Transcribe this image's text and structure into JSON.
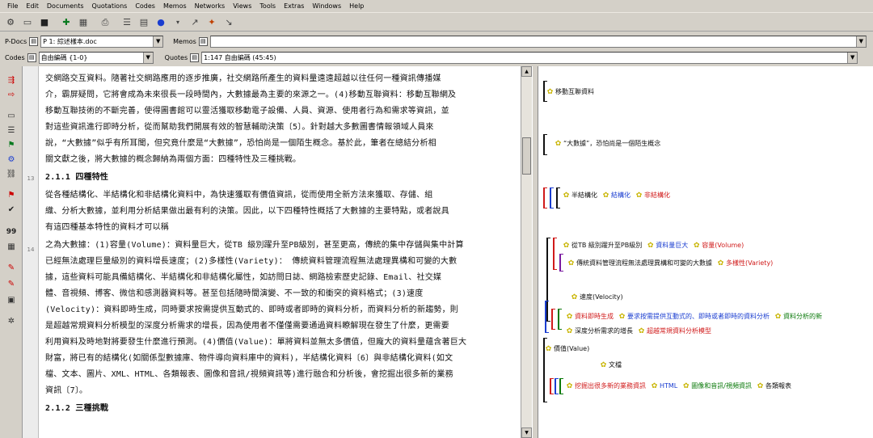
{
  "menu": [
    "File",
    "Edit",
    "Documents",
    "Quotations",
    "Codes",
    "Memos",
    "Networks",
    "Views",
    "Tools",
    "Extras",
    "Windows",
    "Help"
  ],
  "toolbar_icons": [
    "hermeneutic-unit-icon",
    "open-icon",
    "save-icon",
    "add-doc-icon",
    "print-icon",
    "grid-icon",
    "list-icon",
    "network-icon",
    "link-icon",
    "star-icon",
    "cursor-icon"
  ],
  "pdocs": {
    "label": "P-Docs",
    "value": "P 1: 綜述樣本.doc"
  },
  "memos": {
    "label": "Memos",
    "value": ""
  },
  "codes": {
    "label": "Codes",
    "value": "自由編碼 {1-0}"
  },
  "quotes": {
    "label": "Quotes",
    "value": "1:147 自由編碼 (45:45)"
  },
  "line_numbers": [
    "13",
    "14"
  ],
  "text_lines": [
    "交網路交互資料。隨著社交網路應用的逐步推廣，社交網路所產生的資料量遠遠超越以往任何一種資訊傳播媒",
    "介，霸屏疑問，它將會成為未來很長一段時間內，大數據最為主要的來源之一。(4)移動互聯資料：移動互聯網及",
    "移動互聯技術的不斷完善，使得圖書館可以靈活獲取移動電子設備、人員、資源、使用者行為和需求等資訊，並",
    "對這些資訊進行即時分析，從而幫助我們開展有效的智慧輔助決策〔5〕。針對越大多數圖書情報領域人員來",
    "說，“大數據”似乎有所耳聞，但究竟什麼是“大數據”，恐怕尚是一個陌生概念。基於此，筆者在總結分析相",
    "關文獻之後，將大數據的概念歸納為兩個方面：四種特性及三種挑戰。",
    "2.1.1 四種特性",
    "  從各種結構化、半結構化和非結構化資料中，為快速獲取有價值資訊，從而使用全新方法來獲取、存儲、組",
    "織、分析大數據，並利用分析結果做出最有利的決策。因此，以下四種特性概括了大數據的主要特點，或者說具",
    "有這四種基本特性的資料才可以稱",
    "之為大數據：(1)容量(Volume)：資料量巨大，從TB 級別躍升至PB級別，甚至更高，傳統的集中存儲與集中計算",
    "已經無法處理巨量級別的資料增長速度；(2)多樣性(Variety)： 傳統資料管理流程無法處理異構和可變的大數",
    "據，這些資料可能具備結構化、半結構化和非結構化屬性，如訪問日誌、網路檢索歷史記錄、Email、社交媒",
    "體、音視頻、博客、微信和感測器資料等。甚至包括隨時間演變、不一致的和衝突的資料格式；(3)速度",
    "(Velocity)：資料即時生成，同時要求按需提供互動式的、即時或者即時的資料分析，而資料分析的新趨勢，則",
    "是超越常規資料分析模型的深度分析需求的增長，因為使用者不僅僅需要通過資料瞭解現在發生了什麼，更需要",
    "利用資料及時地對將要發生什麼進行預測。(4)價值(Value)：單將資料並無太多價值，但龐大的資料量蘊含著巨大",
    "財富，將已有的結構化(如關係型數據庫、物件導向資料庫中的資料)，半結構化資料〔6〕與非結構化資料(如文",
    "檔、文本、圖片、XML、HTML、各類報表、圖像和音訊/視頻資訊等)進行融合和分析後，會挖掘出很多新的業務",
    "資訊〔7〕。",
    "2.1.2 三種挑戰"
  ],
  "margin_codes": [
    [
      {
        "text": "移動互聯資料",
        "color": "black"
      }
    ],
    [
      {
        "text": "“大數據”，恐怕尚是一個陌生概念",
        "color": "black"
      }
    ],
    [
      {
        "text": "半結構化",
        "color": "black"
      },
      {
        "text": "結構化",
        "color": "blue"
      },
      {
        "text": "非結構化",
        "color": "red"
      }
    ],
    [
      {
        "text": "從TB 級別躍升至PB級別",
        "color": "black"
      },
      {
        "text": "資料量巨大",
        "color": "blue"
      },
      {
        "text": "容量(Volume)",
        "color": "red"
      }
    ],
    [
      {
        "text": "傳統資料管理流程無法處理異構和可變的大數據",
        "color": "black"
      },
      {
        "text": "多樣性(Variety)",
        "color": "red"
      }
    ],
    [
      {
        "text": "速度(Velocity)",
        "color": "black"
      }
    ],
    [
      {
        "text": "資料即時生成",
        "color": "red"
      },
      {
        "text": "要求按需提供互動式的、即時或者即時的資料分析",
        "color": "blue"
      },
      {
        "text": "資料分析的新",
        "color": "green"
      }
    ],
    [
      {
        "text": "深度分析需求的增長",
        "color": "black"
      },
      {
        "text": "超越常規資料分析模型",
        "color": "red"
      }
    ],
    [
      {
        "text": "價值(Value)",
        "color": "black"
      }
    ],
    [
      {
        "text": "文檔",
        "color": "black"
      }
    ],
    [
      {
        "text": "挖掘出很多新的業務資訊",
        "color": "red"
      },
      {
        "text": "HTML",
        "color": "blue"
      },
      {
        "text": "圖像和音訊/視頻資訊",
        "color": "green"
      },
      {
        "text": "各類報表",
        "color": "black"
      }
    ]
  ],
  "colors": {
    "black": "#111111",
    "blue": "#1a3dd0",
    "red": "#d01a1a",
    "green": "#0b7a0b",
    "purple": "#7a1aa0",
    "code_icon": "#c8b400"
  }
}
